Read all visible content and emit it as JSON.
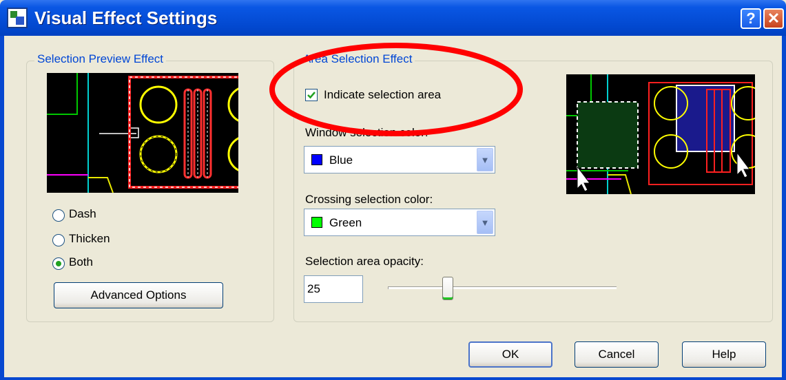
{
  "window": {
    "title": "Visual Effect Settings",
    "help_glyph": "?",
    "close_glyph": "✕"
  },
  "selection_preview": {
    "legend": "Selection Preview Effect",
    "options": [
      "Dash",
      "Thicken",
      "Both"
    ],
    "selected": "Both",
    "advanced_button": "Advanced Options"
  },
  "area_selection": {
    "legend": "Area Selection Effect",
    "indicate_checkbox": {
      "label": "Indicate selection area",
      "checked": true
    },
    "window_color": {
      "label": "Window selection color:",
      "value": "Blue",
      "swatch": "#0000ff"
    },
    "crossing_color": {
      "label": "Crossing selection color:",
      "value": "Green",
      "swatch": "#00ff00"
    },
    "opacity": {
      "label": "Selection area opacity:",
      "value": "25",
      "slider_fraction": 0.25
    }
  },
  "buttons": {
    "ok": "OK",
    "cancel": "Cancel",
    "help": "Help"
  },
  "colors": {
    "title_bar": "#0a57e4",
    "annotation_ellipse": "#ff0000",
    "dialog_bg": "#ece9d8"
  }
}
